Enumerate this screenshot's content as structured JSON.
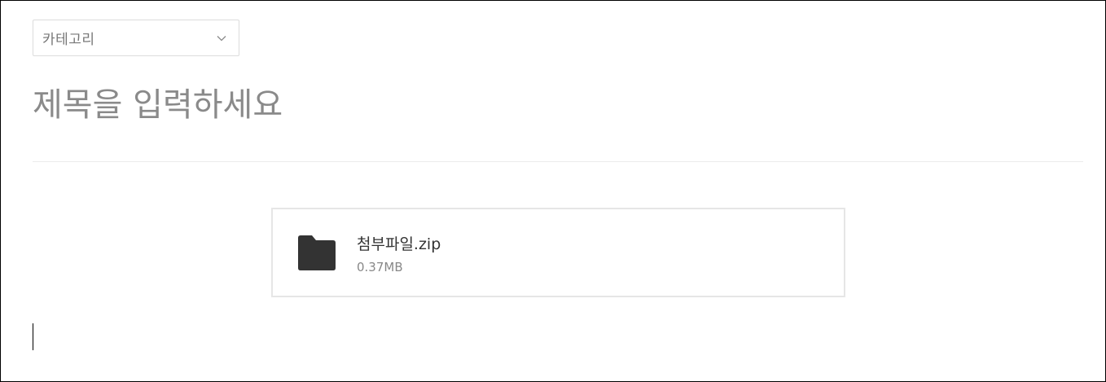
{
  "editor": {
    "category": {
      "label": "카테고리",
      "icon": "chevron-down-icon"
    },
    "title": {
      "value": "",
      "placeholder": "제목을 입력하세요"
    },
    "attachment": {
      "icon": "folder-icon",
      "file_name": "첨부파일.zip",
      "file_size": "0.37MB"
    }
  },
  "colors": {
    "placeholder": "#8a8a8a",
    "border": "#dcdcdc",
    "icon": "#333333"
  }
}
